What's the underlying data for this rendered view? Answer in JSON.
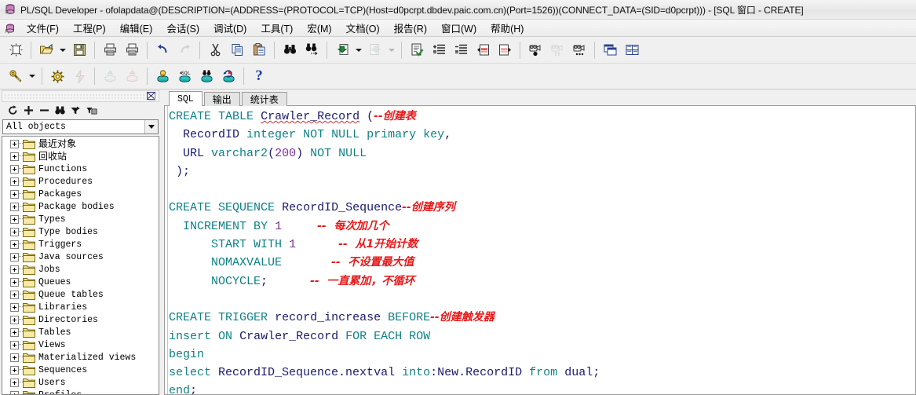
{
  "window": {
    "title": "PL/SQL Developer - ofolapdata@(DESCRIPTION=(ADDRESS=(PROTOCOL=TCP)(Host=d0pcrpt.dbdev.paic.com.cn)(Port=1526))(CONNECT_DATA=(SID=d0pcrpt))) - [SQL 窗口 - CREATE]",
    "icon": "plsql-developer-icon"
  },
  "menubar": {
    "app_icon": "plsql-document-icon",
    "items": [
      {
        "label": "文件(F)",
        "accel": "F"
      },
      {
        "label": "工程(P)",
        "accel": "P"
      },
      {
        "label": "编辑(E)",
        "accel": "E"
      },
      {
        "label": "会话(S)",
        "accel": "S"
      },
      {
        "label": "调试(D)",
        "accel": "D"
      },
      {
        "label": "工具(T)",
        "accel": "T"
      },
      {
        "label": "宏(M)",
        "accel": "M"
      },
      {
        "label": "文档(O)",
        "accel": "O"
      },
      {
        "label": "报告(R)",
        "accel": "R"
      },
      {
        "label": "窗口(W)",
        "accel": "W"
      },
      {
        "label": "帮助(H)",
        "accel": "H"
      }
    ]
  },
  "toolbar_main": {
    "buttons": [
      {
        "name": "new-window-icon",
        "kind": "icon",
        "enabled": true
      },
      {
        "name": "separator",
        "kind": "sep"
      },
      {
        "name": "open-file-icon",
        "kind": "icon",
        "enabled": true
      },
      {
        "name": "open-file-dropdown-icon",
        "kind": "drop",
        "enabled": true
      },
      {
        "name": "save-icon",
        "kind": "icon",
        "enabled": true
      },
      {
        "name": "separator",
        "kind": "sep"
      },
      {
        "name": "print-icon",
        "kind": "icon",
        "enabled": true
      },
      {
        "name": "print-preview-icon",
        "kind": "icon",
        "enabled": true
      },
      {
        "name": "separator",
        "kind": "sep"
      },
      {
        "name": "undo-icon",
        "kind": "icon",
        "enabled": true
      },
      {
        "name": "redo-icon",
        "kind": "icon",
        "enabled": false
      },
      {
        "name": "separator",
        "kind": "sep"
      },
      {
        "name": "cut-icon",
        "kind": "icon",
        "enabled": true
      },
      {
        "name": "copy-icon",
        "kind": "icon",
        "enabled": true
      },
      {
        "name": "paste-icon",
        "kind": "icon",
        "enabled": true
      },
      {
        "name": "separator",
        "kind": "sep"
      },
      {
        "name": "find-icon",
        "kind": "icon",
        "enabled": true
      },
      {
        "name": "find-next-icon",
        "kind": "icon",
        "enabled": true
      },
      {
        "name": "separator",
        "kind": "sep"
      },
      {
        "name": "previous-window-icon",
        "kind": "icon",
        "enabled": true
      },
      {
        "name": "previous-window-dropdown-icon",
        "kind": "drop",
        "enabled": true
      },
      {
        "name": "next-window-icon",
        "kind": "icon",
        "enabled": false
      },
      {
        "name": "next-window-dropdown-icon",
        "kind": "drop",
        "enabled": false
      },
      {
        "name": "separator",
        "kind": "sep"
      },
      {
        "name": "syntax-check-icon",
        "kind": "icon",
        "enabled": true
      },
      {
        "name": "indent-icon",
        "kind": "icon",
        "enabled": true
      },
      {
        "name": "outdent-icon",
        "kind": "icon",
        "enabled": true
      },
      {
        "name": "comment-icon",
        "kind": "icon",
        "enabled": true
      },
      {
        "name": "uncomment-icon",
        "kind": "icon",
        "enabled": true
      },
      {
        "name": "separator",
        "kind": "sep"
      },
      {
        "name": "macro-record-icon",
        "kind": "icon",
        "enabled": true
      },
      {
        "name": "macro-pause-icon",
        "kind": "icon",
        "enabled": false
      },
      {
        "name": "macro-play-icon",
        "kind": "icon",
        "enabled": true
      },
      {
        "name": "separator",
        "kind": "sep"
      },
      {
        "name": "cascade-windows-icon",
        "kind": "icon",
        "enabled": true
      },
      {
        "name": "tile-windows-icon",
        "kind": "icon",
        "enabled": true
      }
    ]
  },
  "toolbar_session": {
    "buttons": [
      {
        "name": "log-on-icon",
        "kind": "icon",
        "enabled": true
      },
      {
        "name": "log-on-dropdown-icon",
        "kind": "drop",
        "enabled": true
      },
      {
        "name": "separator",
        "kind": "sep"
      },
      {
        "name": "execute-icon",
        "kind": "icon",
        "enabled": true
      },
      {
        "name": "break-icon",
        "kind": "icon",
        "enabled": false
      },
      {
        "name": "separator",
        "kind": "sep"
      },
      {
        "name": "commit-icon",
        "kind": "icon",
        "enabled": false
      },
      {
        "name": "rollback-icon",
        "kind": "icon",
        "enabled": false
      },
      {
        "name": "separator",
        "kind": "sep"
      },
      {
        "name": "session-info-icon",
        "kind": "icon",
        "enabled": true
      },
      {
        "name": "sql-window-icon",
        "kind": "icon",
        "enabled": true
      },
      {
        "name": "find-database-objects-icon",
        "kind": "icon",
        "enabled": true
      },
      {
        "name": "rollback-database-icon",
        "kind": "icon",
        "enabled": true
      },
      {
        "name": "separator",
        "kind": "sep"
      },
      {
        "name": "help-button",
        "kind": "help",
        "label": "?",
        "enabled": true
      }
    ]
  },
  "browser": {
    "panel_close_label": "close-panel",
    "tools": [
      {
        "name": "refresh-icon",
        "glyph": "refresh"
      },
      {
        "name": "expand-all-icon",
        "glyph": "plus"
      },
      {
        "name": "collapse-all-icon",
        "glyph": "minus"
      },
      {
        "name": "find-object-icon",
        "glyph": "binoculars"
      },
      {
        "name": "filter-icon",
        "glyph": "filter"
      },
      {
        "name": "object-properties-icon",
        "glyph": "props"
      }
    ],
    "filter": {
      "value": "All objects",
      "placeholder": "All objects"
    },
    "tree_items": [
      {
        "label": "最近对象",
        "cjk": true
      },
      {
        "label": "回收站",
        "cjk": true
      },
      {
        "label": "Functions",
        "cjk": false
      },
      {
        "label": "Procedures",
        "cjk": false
      },
      {
        "label": "Packages",
        "cjk": false
      },
      {
        "label": "Package bodies",
        "cjk": false
      },
      {
        "label": "Types",
        "cjk": false
      },
      {
        "label": "Type bodies",
        "cjk": false
      },
      {
        "label": "Triggers",
        "cjk": false
      },
      {
        "label": "Java sources",
        "cjk": false
      },
      {
        "label": "Jobs",
        "cjk": false
      },
      {
        "label": "Queues",
        "cjk": false
      },
      {
        "label": "Queue tables",
        "cjk": false
      },
      {
        "label": "Libraries",
        "cjk": false
      },
      {
        "label": "Directories",
        "cjk": false
      },
      {
        "label": "Tables",
        "cjk": false
      },
      {
        "label": "Views",
        "cjk": false
      },
      {
        "label": "Materialized views",
        "cjk": false
      },
      {
        "label": "Sequences",
        "cjk": false
      },
      {
        "label": "Users",
        "cjk": false
      },
      {
        "label": "Profiles",
        "cjk": false
      }
    ]
  },
  "editor": {
    "tabs": [
      {
        "label": "SQL",
        "active": true
      },
      {
        "label": "输出",
        "active": false
      },
      {
        "label": "统计表",
        "active": false
      }
    ],
    "code_lines": [
      [
        {
          "t": "CREATE",
          "c": "kw"
        },
        {
          "t": " ",
          "c": "pun"
        },
        {
          "t": "TABLE",
          "c": "kw"
        },
        {
          "t": " ",
          "c": "pun"
        },
        {
          "t": "Crawler_Record",
          "c": "id spell"
        },
        {
          "t": " (",
          "c": "pun"
        },
        {
          "t": "--创建表",
          "c": "cmt cjk"
        }
      ],
      [
        {
          "t": "  ",
          "c": "pun"
        },
        {
          "t": "RecordID",
          "c": "id"
        },
        {
          "t": " ",
          "c": "pun"
        },
        {
          "t": "integer",
          "c": "kw"
        },
        {
          "t": " ",
          "c": "pun"
        },
        {
          "t": "NOT",
          "c": "kw"
        },
        {
          "t": " ",
          "c": "pun"
        },
        {
          "t": "NULL",
          "c": "kw"
        },
        {
          "t": " ",
          "c": "pun"
        },
        {
          "t": "primary",
          "c": "kw"
        },
        {
          "t": " ",
          "c": "pun"
        },
        {
          "t": "key",
          "c": "kw"
        },
        {
          "t": ",",
          "c": "pun"
        }
      ],
      [
        {
          "t": "  ",
          "c": "pun"
        },
        {
          "t": "URL",
          "c": "id"
        },
        {
          "t": " ",
          "c": "pun"
        },
        {
          "t": "varchar2",
          "c": "kw"
        },
        {
          "t": "(",
          "c": "pun"
        },
        {
          "t": "200",
          "c": "num"
        },
        {
          "t": ") ",
          "c": "pun"
        },
        {
          "t": "NOT",
          "c": "kw"
        },
        {
          "t": " ",
          "c": "pun"
        },
        {
          "t": "NULL",
          "c": "kw"
        }
      ],
      [
        {
          "t": " );",
          "c": "pun"
        }
      ],
      [
        {
          "t": "",
          "c": "pun"
        }
      ],
      [
        {
          "t": "CREATE",
          "c": "kw"
        },
        {
          "t": " ",
          "c": "pun"
        },
        {
          "t": "SEQUENCE",
          "c": "kw"
        },
        {
          "t": " ",
          "c": "pun"
        },
        {
          "t": "RecordID_Sequence",
          "c": "id"
        },
        {
          "t": "--创建序列",
          "c": "cmt cjk"
        }
      ],
      [
        {
          "t": "  ",
          "c": "pun"
        },
        {
          "t": "INCREMENT",
          "c": "kw"
        },
        {
          "t": " ",
          "c": "pun"
        },
        {
          "t": "BY",
          "c": "kw"
        },
        {
          "t": " ",
          "c": "pun"
        },
        {
          "t": "1",
          "c": "num"
        },
        {
          "t": "     ",
          "c": "pun"
        },
        {
          "t": "--  每次加几个",
          "c": "cmt cjk"
        }
      ],
      [
        {
          "t": "      ",
          "c": "pun"
        },
        {
          "t": "START",
          "c": "kw"
        },
        {
          "t": " ",
          "c": "pun"
        },
        {
          "t": "WITH",
          "c": "kw"
        },
        {
          "t": " ",
          "c": "pun"
        },
        {
          "t": "1",
          "c": "num"
        },
        {
          "t": "      ",
          "c": "pun"
        },
        {
          "t": "--  从1开始计数",
          "c": "cmt cjk"
        }
      ],
      [
        {
          "t": "      ",
          "c": "pun"
        },
        {
          "t": "NOMAXVALUE",
          "c": "kw"
        },
        {
          "t": "       ",
          "c": "pun"
        },
        {
          "t": "--  不设置最大值",
          "c": "cmt cjk"
        }
      ],
      [
        {
          "t": "      ",
          "c": "pun"
        },
        {
          "t": "NOCYCLE",
          "c": "kw"
        },
        {
          "t": ";",
          "c": "pun"
        },
        {
          "t": "      ",
          "c": "pun"
        },
        {
          "t": "--  一直累加，不循环",
          "c": "cmt cjk"
        }
      ],
      [
        {
          "t": "",
          "c": "pun"
        }
      ],
      [
        {
          "t": "CREATE",
          "c": "kw"
        },
        {
          "t": " ",
          "c": "pun"
        },
        {
          "t": "TRIGGER",
          "c": "kw"
        },
        {
          "t": " ",
          "c": "pun"
        },
        {
          "t": "record_increase",
          "c": "id"
        },
        {
          "t": " ",
          "c": "pun"
        },
        {
          "t": "BEFORE",
          "c": "kw"
        },
        {
          "t": "--创建触发器",
          "c": "cmt cjk"
        }
      ],
      [
        {
          "t": "insert",
          "c": "kw"
        },
        {
          "t": " ",
          "c": "pun"
        },
        {
          "t": "ON",
          "c": "kw"
        },
        {
          "t": " ",
          "c": "pun"
        },
        {
          "t": "Crawler_Record",
          "c": "id"
        },
        {
          "t": " ",
          "c": "pun"
        },
        {
          "t": "FOR",
          "c": "kw"
        },
        {
          "t": " ",
          "c": "pun"
        },
        {
          "t": "EACH",
          "c": "kw"
        },
        {
          "t": " ",
          "c": "pun"
        },
        {
          "t": "ROW",
          "c": "kw"
        }
      ],
      [
        {
          "t": "begin",
          "c": "kw"
        }
      ],
      [
        {
          "t": "select",
          "c": "kw"
        },
        {
          "t": " ",
          "c": "pun"
        },
        {
          "t": "RecordID_Sequence.nextval",
          "c": "id"
        },
        {
          "t": " ",
          "c": "pun"
        },
        {
          "t": "into",
          "c": "kw"
        },
        {
          "t": ":",
          "c": "pun"
        },
        {
          "t": "New.RecordID",
          "c": "id"
        },
        {
          "t": " ",
          "c": "pun"
        },
        {
          "t": "from",
          "c": "kw"
        },
        {
          "t": " ",
          "c": "pun"
        },
        {
          "t": "dual",
          "c": "id"
        },
        {
          "t": ";",
          "c": "pun"
        }
      ],
      [
        {
          "t": "end",
          "c": "kw"
        },
        {
          "t": ";",
          "c": "pun"
        }
      ]
    ]
  },
  "colors": {
    "keyword": "#0f8186",
    "identifier": "#1a1a6e",
    "number": "#7a2f9e",
    "comment": "#e8191a",
    "editor_bg": "#ffffff",
    "chrome_bg": "#f0f0f0"
  }
}
